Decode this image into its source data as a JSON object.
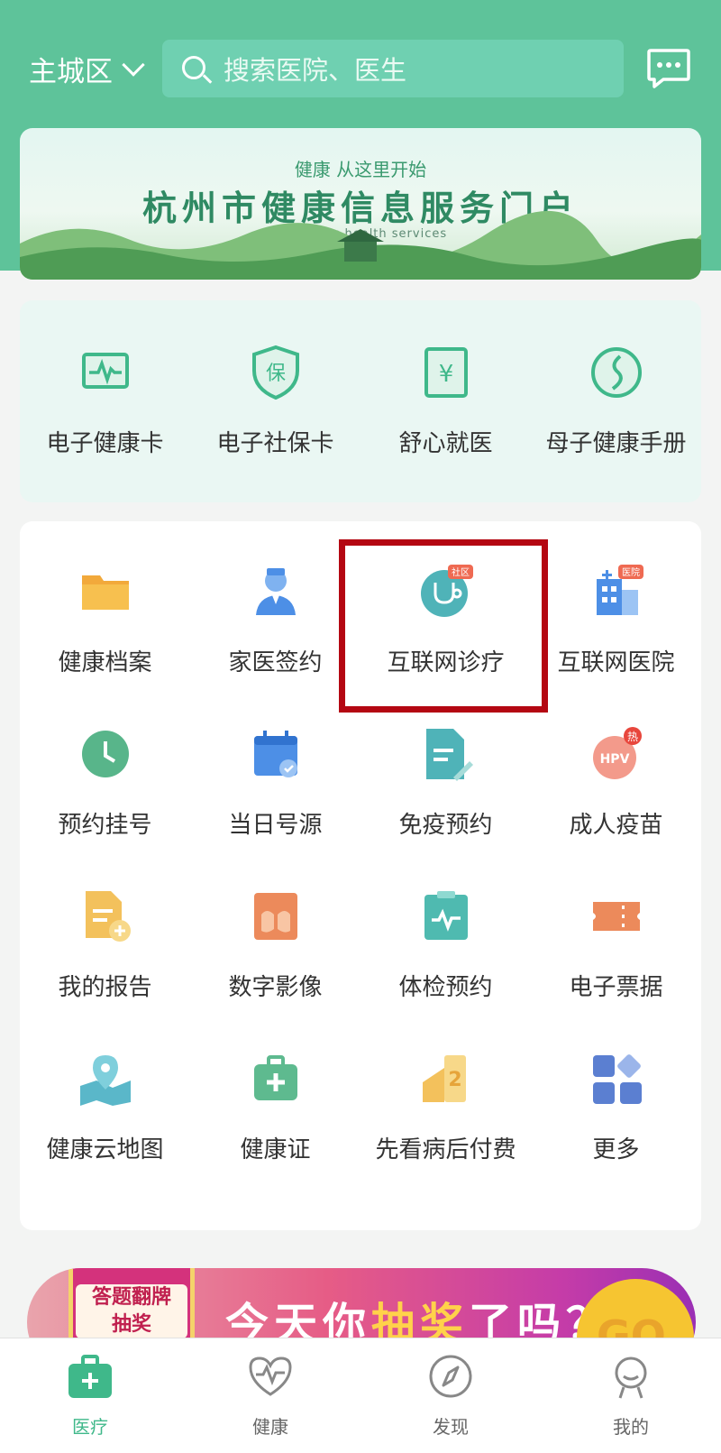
{
  "header": {
    "city": "主城区",
    "search_placeholder": "搜索医院、医生"
  },
  "banner": {
    "subtitle": "健康  从这里开始",
    "title": "杭州市健康信息服务门户",
    "english": "Hangzhou health services"
  },
  "quick_cards": [
    {
      "label": "电子健康卡",
      "icon": "heartbeat-card-icon"
    },
    {
      "label": "电子社保卡",
      "icon": "shield-bao-icon"
    },
    {
      "label": "舒心就医",
      "icon": "yuan-receipt-icon"
    },
    {
      "label": "母子健康手册",
      "icon": "mother-child-icon"
    }
  ],
  "services": [
    {
      "label": "健康档案",
      "icon": "folder-icon"
    },
    {
      "label": "家医签约",
      "icon": "doctor-icon"
    },
    {
      "label": "互联网诊疗",
      "icon": "stethoscope-icon",
      "badge": "社区"
    },
    {
      "label": "互联网医院",
      "icon": "hospital-icon",
      "badge": "医院"
    },
    {
      "label": "预约挂号",
      "icon": "clock-icon"
    },
    {
      "label": "当日号源",
      "icon": "calendar-icon"
    },
    {
      "label": "免疫预约",
      "icon": "document-pen-icon"
    },
    {
      "label": "成人疫苗",
      "icon": "hpv-icon",
      "badge": "热",
      "text": "HPV"
    },
    {
      "label": "我的报告",
      "icon": "report-icon"
    },
    {
      "label": "数字影像",
      "icon": "lungs-icon"
    },
    {
      "label": "体检预约",
      "icon": "clipboard-pulse-icon"
    },
    {
      "label": "电子票据",
      "icon": "ticket-icon"
    },
    {
      "label": "健康云地图",
      "icon": "map-pin-icon"
    },
    {
      "label": "健康证",
      "icon": "medical-kit-icon"
    },
    {
      "label": "先看病后付费",
      "icon": "card-pay-icon"
    },
    {
      "label": "更多",
      "icon": "more-grid-icon"
    }
  ],
  "promo": {
    "box_label_1": "答题翻牌",
    "box_label_2": "抽奖",
    "slogan_a": "今天你",
    "slogan_b": "抽奖",
    "slogan_c": "了吗？",
    "go": "GO"
  },
  "tabs": [
    {
      "label": "医疗",
      "icon": "medical-bag-icon",
      "active": true
    },
    {
      "label": "健康",
      "icon": "heart-pulse-icon",
      "active": false
    },
    {
      "label": "发现",
      "icon": "compass-icon",
      "active": false
    },
    {
      "label": "我的",
      "icon": "person-icon",
      "active": false
    }
  ],
  "colors": {
    "brand": "#5ec39a",
    "highlight": "#b40712"
  }
}
